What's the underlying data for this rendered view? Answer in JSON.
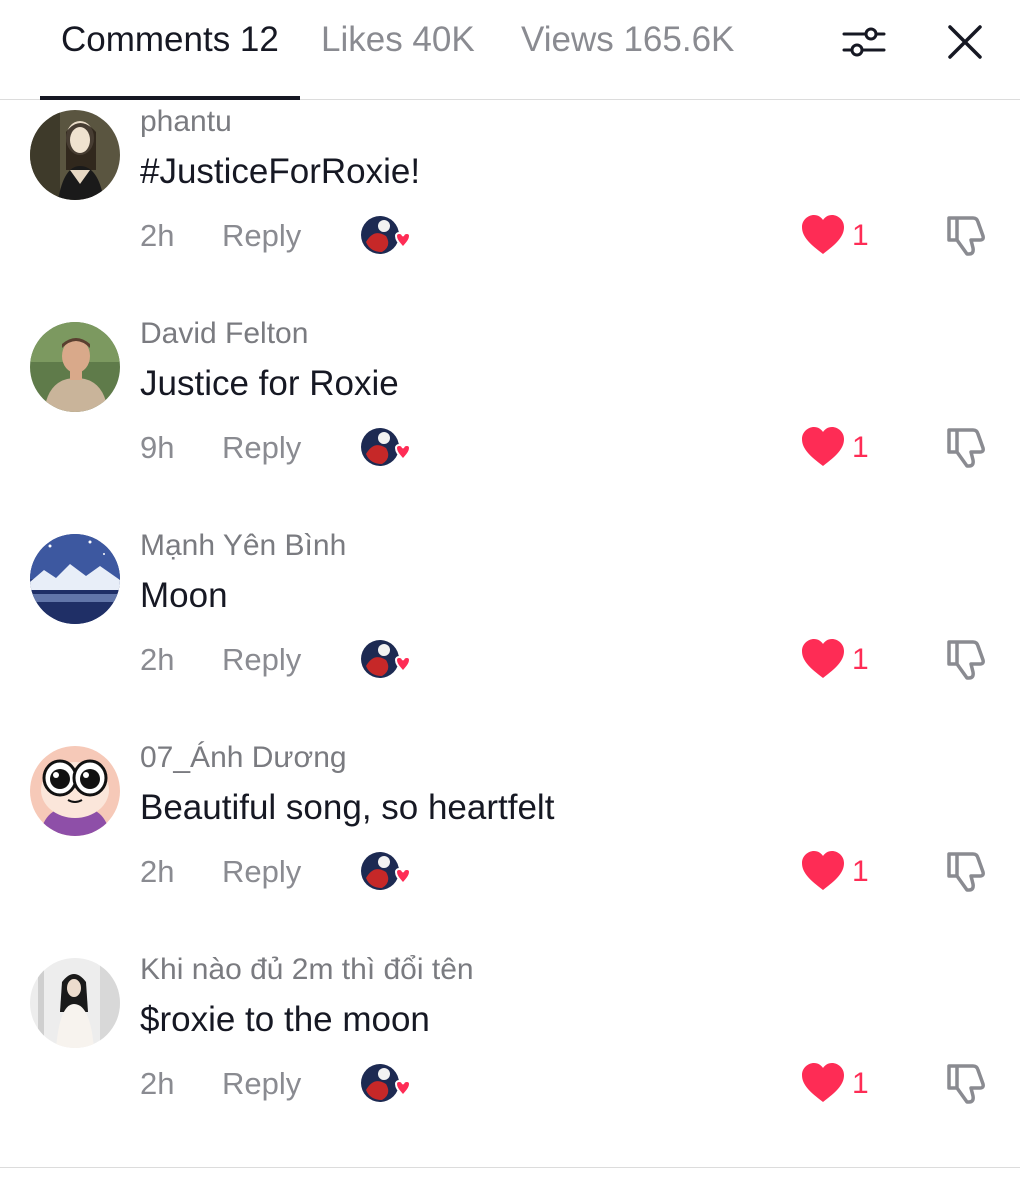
{
  "tabs": [
    {
      "label": "Comments 12",
      "active": true
    },
    {
      "label": "Likes 40K",
      "active": false
    },
    {
      "label": "Views 165.6K",
      "active": false
    }
  ],
  "header_icons": {
    "filter": "sliders-icon",
    "close": "close-icon"
  },
  "reply_label": "Reply",
  "colors": {
    "accent_heart": "#fe2c55",
    "text_primary": "#161823",
    "text_secondary": "#8a8b91"
  },
  "comments": [
    {
      "username": "phantu",
      "text": "#JusticeForRoxie!",
      "time": "2h",
      "likes": "1"
    },
    {
      "username": "David Felton",
      "text": "Justice for Roxie",
      "time": "9h",
      "likes": "1"
    },
    {
      "username": "Mạnh Yên Bình",
      "text": "Moon",
      "time": "2h",
      "likes": "1"
    },
    {
      "username": "07_Ánh Dương",
      "text": "Beautiful song, so heartfelt",
      "time": "2h",
      "likes": "1"
    },
    {
      "username": "Khi nào đủ 2m thì đổi tên",
      "text": "$roxie to the moon",
      "time": "2h",
      "likes": "1"
    }
  ]
}
